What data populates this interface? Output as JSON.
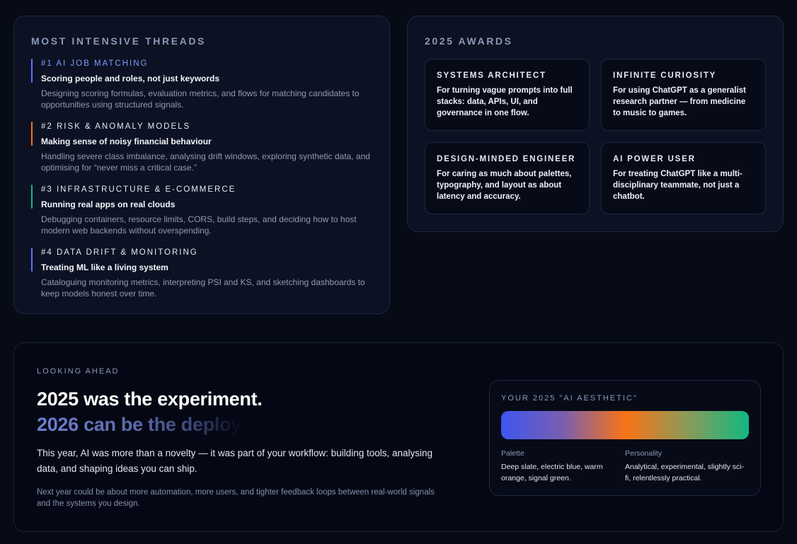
{
  "threads": {
    "title": "Most intensive threads",
    "items": [
      {
        "tag": "#1 AI Job Matching",
        "headline": "Scoring people and roles, not just keywords",
        "desc": "Designing scoring formulas, evaluation metrics, and flows for matching candidates to opportunities using structured signals.",
        "tag_color": "#7f9bff",
        "accent": "#5b74ff"
      },
      {
        "tag": "#2 Risk & Anomaly Models",
        "headline": "Making sense of noisy financial behaviour",
        "desc": "Handling severe class imbalance, analysing drift windows, exploring synthetic data, and optimising for “never miss a critical case.”",
        "tag_color": "#e6eaf3",
        "accent": "#f97316"
      },
      {
        "tag": "#3 Infrastructure & E-commerce",
        "headline": "Running real apps on real clouds",
        "desc": "Debugging containers, resource limits, CORS, build steps, and deciding how to host modern web backends without overspending.",
        "tag_color": "#e6eaf3",
        "accent": "#10b981"
      },
      {
        "tag": "#4 Data Drift & Monitoring",
        "headline": "Treating ML like a living system",
        "desc": "Cataloguing monitoring metrics, interpreting PSI and KS, and sketching dashboards to keep models honest over time.",
        "tag_color": "#e6eaf3",
        "accent": "#5b74ff"
      }
    ]
  },
  "awards": {
    "title": "2025 Awards",
    "items": [
      {
        "name": "Systems Architect",
        "text": "For turning vague prompts into full stacks: data, APIs, UI, and governance in one flow."
      },
      {
        "name": "Infinite Curiosity",
        "text": "For using ChatGPT as a generalist research partner — from medicine to music to games."
      },
      {
        "name": "Design-Minded Engineer",
        "text": "For caring as much about palettes, typography, and layout as about latency and accuracy."
      },
      {
        "name": "AI Power User",
        "text": "For treating ChatGPT like a multi-disciplinary teammate, not just a chatbot."
      }
    ]
  },
  "ahead": {
    "label": "Looking ahead",
    "headline1": "2025 was the experiment.",
    "headline2": "2026 can be the deployment.",
    "p1": "This year, AI was more than a novelty — it was part of your workflow: building tools, analysing data, and shaping ideas you can ship.",
    "p2": "Next year could be about more automation, more users, and tighter feedback loops between real-world signals and the systems you design.",
    "aesthetic": {
      "title": "Your 2025 \"AI Aesthetic\"",
      "gradient_colors": [
        "#3e56f0",
        "#7a5fb0",
        "#f97316",
        "#8c9a5a",
        "#10b981"
      ],
      "palette_label": "Palette",
      "palette_value": "Deep slate, electric blue, warm orange, signal green.",
      "personality_label": "Personality",
      "personality_value": "Analytical, experimental, slightly sci-fi, relentlessly practical."
    }
  }
}
